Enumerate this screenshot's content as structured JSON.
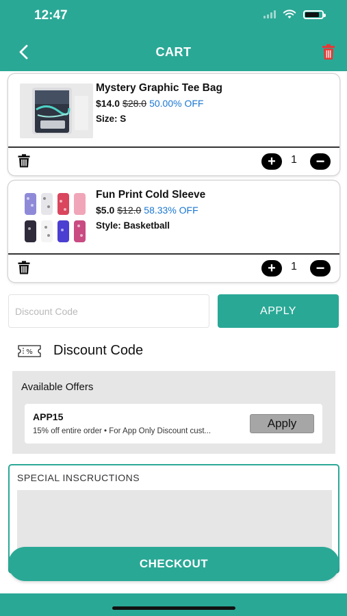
{
  "status_bar": {
    "time": "12:47"
  },
  "header": {
    "title": "CART"
  },
  "cart_items": [
    {
      "name": "Mystery Graphic Tee Bag",
      "price": "$14.0",
      "original_price": "$28.0",
      "discount": "50.00% OFF",
      "variant": "Size: S",
      "quantity": "1",
      "plus_symbol": "+",
      "minus_symbol": "−"
    },
    {
      "name": "Fun Print Cold Sleeve",
      "price": "$5.0",
      "original_price": "$12.0",
      "discount": "58.33% OFF",
      "variant": "Style: Basketball",
      "quantity": "1",
      "plus_symbol": "+",
      "minus_symbol": "−"
    }
  ],
  "discount": {
    "placeholder": "Discount Code",
    "apply_label": "APPLY",
    "section_title": "Discount Code"
  },
  "offers": {
    "title": "Available Offers",
    "items": [
      {
        "code": "APP15",
        "description": "15% off entire order • For App Only Discount cust...",
        "apply_label": "Apply"
      }
    ]
  },
  "instructions": {
    "label": "SPECIAL INSCRUCTIONS"
  },
  "checkout": {
    "label": "CHECKOUT"
  },
  "colors": {
    "accent": "#2aa896",
    "discount_text": "#1976d2",
    "delete_red": "#e53935"
  },
  "icons": {
    "back": "chevron-left-icon",
    "delete_all": "trash-icon",
    "delete_item": "trash-icon",
    "discount_tag": "discount-tag-icon"
  }
}
